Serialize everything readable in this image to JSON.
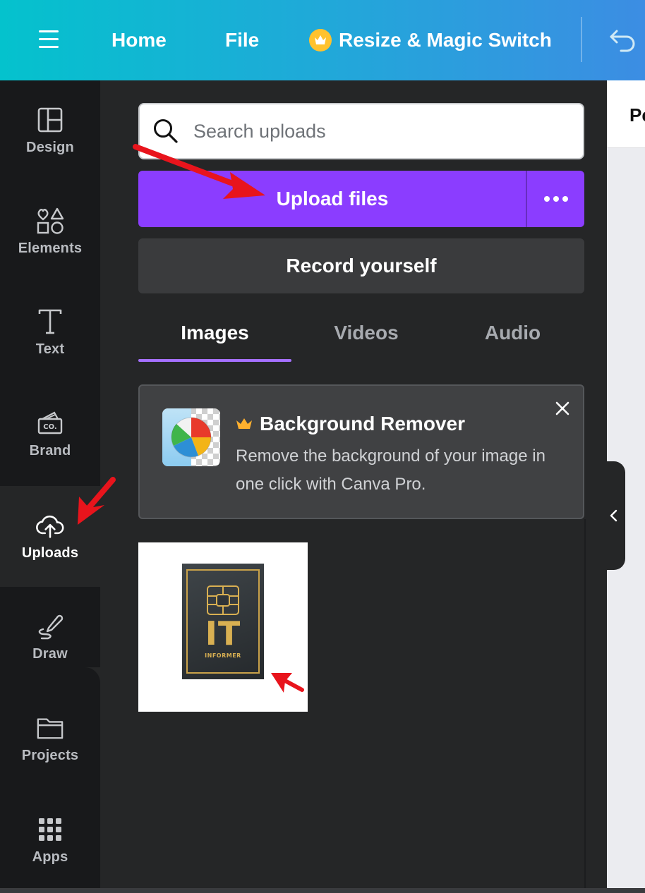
{
  "topbar": {
    "menu_icon": "hamburger-menu-icon",
    "home": "Home",
    "file": "File",
    "resize": "Resize & Magic Switch",
    "resize_icon": "crown-icon",
    "undo_icon": "undo-icon"
  },
  "sidebar": {
    "items": [
      {
        "label": "Design",
        "icon": "layout-icon"
      },
      {
        "label": "Elements",
        "icon": "shapes-icon"
      },
      {
        "label": "Text",
        "icon": "text-icon"
      },
      {
        "label": "Brand",
        "icon": "brand-icon"
      },
      {
        "label": "Uploads",
        "icon": "cloud-upload-icon",
        "active": true
      },
      {
        "label": "Draw",
        "icon": "draw-icon"
      },
      {
        "label": "Projects",
        "icon": "folder-icon"
      },
      {
        "label": "Apps",
        "icon": "apps-grid-icon"
      }
    ]
  },
  "panel": {
    "search_placeholder": "Search uploads",
    "upload_button": "Upload files",
    "record_button": "Record yourself",
    "tabs": [
      {
        "label": "Images",
        "active": true
      },
      {
        "label": "Videos"
      },
      {
        "label": "Audio"
      }
    ],
    "promo": {
      "title": "Background Remover",
      "description": "Remove the background of your image in one click with Canva Pro."
    },
    "uploaded_image": {
      "logo_text": "IT",
      "logo_subtext": "INFORMER"
    }
  },
  "canvas": {
    "header_fragment": "Pe"
  },
  "colors": {
    "topbar_gradient_start": "#04c2cd",
    "topbar_gradient_end": "#3c8de3",
    "upload_button": "#8b3dff",
    "tab_underline": "#a570ff",
    "crown": "#ffc22e",
    "annotation_arrow": "#e8141c"
  }
}
